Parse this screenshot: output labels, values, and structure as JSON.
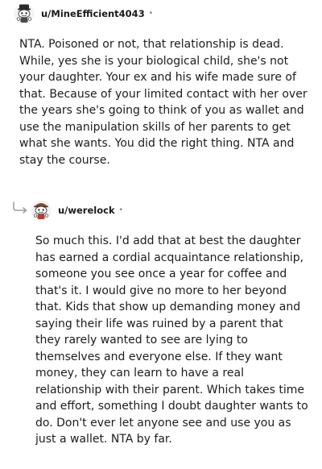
{
  "comments": [
    {
      "username": "u/MineEfficient4043",
      "separator": "•",
      "avatar_icon": "snoo-avatar-icon",
      "body": "NTA. Poisoned or not, that relationship is dead. While, yes she is your biological child, she's not your daughter. Your ex and his wife made sure of that. Because of your limited contact with her over the years she's going to think of you as wallet and use the manipulation skills of her parents to get what she wants. You did the right thing. NTA and stay the course."
    },
    {
      "username": "u/werelock",
      "separator": "•",
      "avatar_icon": "snoo-avatar-icon",
      "reply_icon": "reply-arrow-icon",
      "body": "So much this. I'd add that at best the daughter has earned a cordial acquaintance relationship, someone you see once a year for coffee and that's it. I would give no more to her beyond that. Kids that show up demanding money and saying their life was ruined by a parent that they rarely wanted to see are lying to themselves and everyone else. If they want money, they can learn to have a real relationship with their parent. Which takes time and effort, something I doubt daughter wants to do. Don't ever let anyone see and use you as just a wallet. NTA by far."
    }
  ]
}
